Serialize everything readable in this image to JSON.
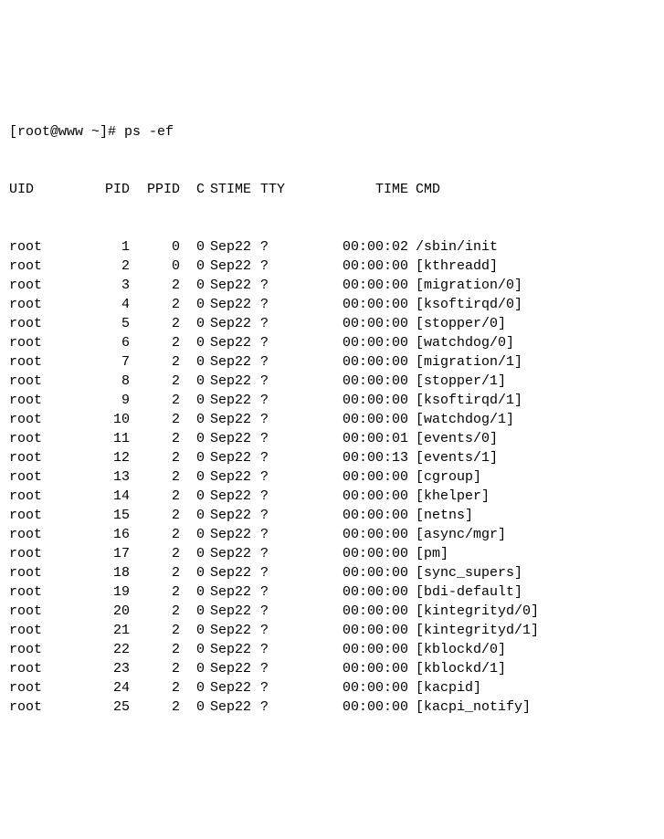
{
  "prompt": "[root@www ~]# ",
  "command": "ps -ef",
  "headers": {
    "uid": "UID",
    "pid": "PID",
    "ppid": "PPID",
    "c": "C",
    "stime": "STIME",
    "tty": "TTY",
    "time": "TIME",
    "cmd": "CMD"
  },
  "rows": [
    {
      "uid": "root",
      "pid": "1",
      "ppid": "0",
      "c": "0",
      "stime": "Sep22",
      "tty": "?",
      "time": "00:00:02",
      "cmd": "/sbin/init"
    },
    {
      "uid": "root",
      "pid": "2",
      "ppid": "0",
      "c": "0",
      "stime": "Sep22",
      "tty": "?",
      "time": "00:00:00",
      "cmd": "[kthreadd]"
    },
    {
      "uid": "root",
      "pid": "3",
      "ppid": "2",
      "c": "0",
      "stime": "Sep22",
      "tty": "?",
      "time": "00:00:00",
      "cmd": "[migration/0]"
    },
    {
      "uid": "root",
      "pid": "4",
      "ppid": "2",
      "c": "0",
      "stime": "Sep22",
      "tty": "?",
      "time": "00:00:00",
      "cmd": "[ksoftirqd/0]"
    },
    {
      "uid": "root",
      "pid": "5",
      "ppid": "2",
      "c": "0",
      "stime": "Sep22",
      "tty": "?",
      "time": "00:00:00",
      "cmd": "[stopper/0]"
    },
    {
      "uid": "root",
      "pid": "6",
      "ppid": "2",
      "c": "0",
      "stime": "Sep22",
      "tty": "?",
      "time": "00:00:00",
      "cmd": "[watchdog/0]"
    },
    {
      "uid": "root",
      "pid": "7",
      "ppid": "2",
      "c": "0",
      "stime": "Sep22",
      "tty": "?",
      "time": "00:00:00",
      "cmd": "[migration/1]"
    },
    {
      "uid": "root",
      "pid": "8",
      "ppid": "2",
      "c": "0",
      "stime": "Sep22",
      "tty": "?",
      "time": "00:00:00",
      "cmd": "[stopper/1]"
    },
    {
      "uid": "root",
      "pid": "9",
      "ppid": "2",
      "c": "0",
      "stime": "Sep22",
      "tty": "?",
      "time": "00:00:00",
      "cmd": "[ksoftirqd/1]"
    },
    {
      "uid": "root",
      "pid": "10",
      "ppid": "2",
      "c": "0",
      "stime": "Sep22",
      "tty": "?",
      "time": "00:00:00",
      "cmd": "[watchdog/1]"
    },
    {
      "uid": "root",
      "pid": "11",
      "ppid": "2",
      "c": "0",
      "stime": "Sep22",
      "tty": "?",
      "time": "00:00:01",
      "cmd": "[events/0]"
    },
    {
      "uid": "root",
      "pid": "12",
      "ppid": "2",
      "c": "0",
      "stime": "Sep22",
      "tty": "?",
      "time": "00:00:13",
      "cmd": "[events/1]"
    },
    {
      "uid": "root",
      "pid": "13",
      "ppid": "2",
      "c": "0",
      "stime": "Sep22",
      "tty": "?",
      "time": "00:00:00",
      "cmd": "[cgroup]"
    },
    {
      "uid": "root",
      "pid": "14",
      "ppid": "2",
      "c": "0",
      "stime": "Sep22",
      "tty": "?",
      "time": "00:00:00",
      "cmd": "[khelper]"
    },
    {
      "uid": "root",
      "pid": "15",
      "ppid": "2",
      "c": "0",
      "stime": "Sep22",
      "tty": "?",
      "time": "00:00:00",
      "cmd": "[netns]"
    },
    {
      "uid": "root",
      "pid": "16",
      "ppid": "2",
      "c": "0",
      "stime": "Sep22",
      "tty": "?",
      "time": "00:00:00",
      "cmd": "[async/mgr]"
    },
    {
      "uid": "root",
      "pid": "17",
      "ppid": "2",
      "c": "0",
      "stime": "Sep22",
      "tty": "?",
      "time": "00:00:00",
      "cmd": "[pm]"
    },
    {
      "uid": "root",
      "pid": "18",
      "ppid": "2",
      "c": "0",
      "stime": "Sep22",
      "tty": "?",
      "time": "00:00:00",
      "cmd": "[sync_supers]"
    },
    {
      "uid": "root",
      "pid": "19",
      "ppid": "2",
      "c": "0",
      "stime": "Sep22",
      "tty": "?",
      "time": "00:00:00",
      "cmd": "[bdi-default]"
    },
    {
      "uid": "root",
      "pid": "20",
      "ppid": "2",
      "c": "0",
      "stime": "Sep22",
      "tty": "?",
      "time": "00:00:00",
      "cmd": "[kintegrityd/0]"
    },
    {
      "uid": "root",
      "pid": "21",
      "ppid": "2",
      "c": "0",
      "stime": "Sep22",
      "tty": "?",
      "time": "00:00:00",
      "cmd": "[kintegrityd/1]"
    },
    {
      "uid": "root",
      "pid": "22",
      "ppid": "2",
      "c": "0",
      "stime": "Sep22",
      "tty": "?",
      "time": "00:00:00",
      "cmd": "[kblockd/0]"
    },
    {
      "uid": "root",
      "pid": "23",
      "ppid": "2",
      "c": "0",
      "stime": "Sep22",
      "tty": "?",
      "time": "00:00:00",
      "cmd": "[kblockd/1]"
    },
    {
      "uid": "root",
      "pid": "24",
      "ppid": "2",
      "c": "0",
      "stime": "Sep22",
      "tty": "?",
      "time": "00:00:00",
      "cmd": "[kacpid]"
    },
    {
      "uid": "root",
      "pid": "25",
      "ppid": "2",
      "c": "0",
      "stime": "Sep22",
      "tty": "?",
      "time": "00:00:00",
      "cmd": "[kacpi_notify]"
    }
  ]
}
